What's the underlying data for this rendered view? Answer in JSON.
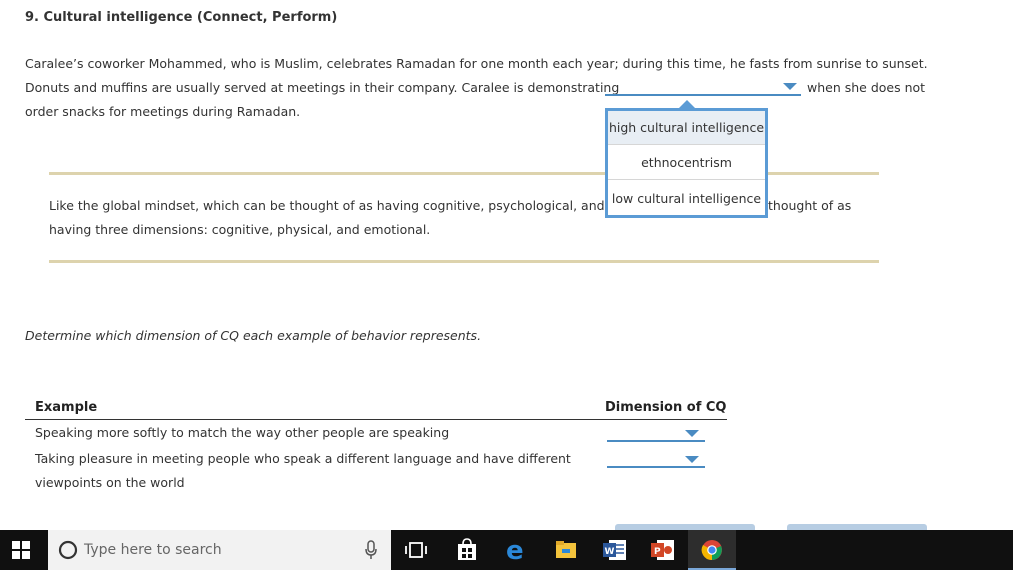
{
  "question": {
    "title": "9. Cultural intelligence (Connect, Perform)",
    "line1": "Caralee’s coworker Mohammed, who is Muslim, celebrates Ramadan for one month each year; during this time, he fasts from sunrise to sunset.",
    "line2_before": "Donuts and muffins are usually served at meetings in their company. Caralee is demonstrating",
    "line2_after": "when she does not",
    "line3": "order snacks for meetings during Ramadan."
  },
  "dropdown": {
    "selected": "",
    "options": [
      "high cultural intelligence",
      "ethnocentrism",
      "low cultural intelligence"
    ]
  },
  "info": {
    "line1_before": "Like the global mindset, which can be thought of as having cognitive, psychological, and soc",
    "line1_after": "thought of as",
    "line2": "having three dimensions: cognitive, physical, and emotional."
  },
  "instruction": "Determine which dimension of CQ each example of behavior represents.",
  "table": {
    "headers": [
      "Example",
      "Dimension of CQ"
    ],
    "rows": [
      {
        "example": "Speaking more softly to match the way other people are speaking",
        "selected": ""
      },
      {
        "example_line1": "Taking pleasure in meeting people who speak a different language and have different",
        "example_line2": "viewpoints on the world",
        "selected": ""
      }
    ]
  },
  "taskbar": {
    "search_placeholder": "Type here to search",
    "icons": [
      "windows-start-icon",
      "search-circle-icon",
      "microphone-icon",
      "task-view-icon",
      "store-icon",
      "edge-icon",
      "file-explorer-icon",
      "word-icon",
      "powerpoint-icon",
      "chrome-icon"
    ]
  },
  "colors": {
    "accent_blue": "#4a8bc2",
    "rule_tan": "#ddd3ad",
    "taskbar_bg": "#101010"
  }
}
